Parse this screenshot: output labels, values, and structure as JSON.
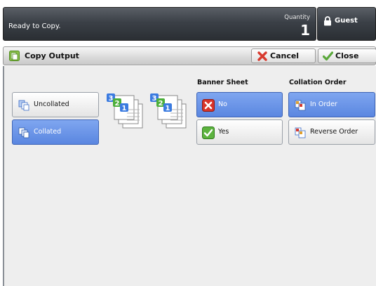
{
  "status": {
    "message": "Ready to Copy.",
    "quantity_label": "Quantity",
    "quantity_value": "1"
  },
  "user": {
    "label": "Guest",
    "icon": "padlock-icon"
  },
  "header": {
    "title": "Copy Output",
    "title_icon": "copy-output-icon",
    "cancel_label": "Cancel",
    "close_label": "Close"
  },
  "collation_mode": {
    "options": [
      {
        "label": "Uncollated",
        "selected": false
      },
      {
        "label": "Collated",
        "selected": true
      }
    ],
    "stack_numbers": [
      "3",
      "2",
      "1"
    ]
  },
  "banner_sheet": {
    "heading": "Banner Sheet",
    "options": [
      {
        "label": "No",
        "selected": true,
        "icon": "red-x-icon"
      },
      {
        "label": "Yes",
        "selected": false,
        "icon": "green-check-icon"
      }
    ]
  },
  "collation_order": {
    "heading": "Collation Order",
    "options": [
      {
        "label": "In Order",
        "selected": true
      },
      {
        "label": "Reverse Order",
        "selected": false
      }
    ]
  },
  "colors": {
    "selected": "#6b95e8",
    "status_bar": "#3b4047",
    "badge_blue": "#3b7be0",
    "badge_green": "#4caf3a",
    "cancel_red": "#d83a2e",
    "close_green": "#5aa83a"
  }
}
